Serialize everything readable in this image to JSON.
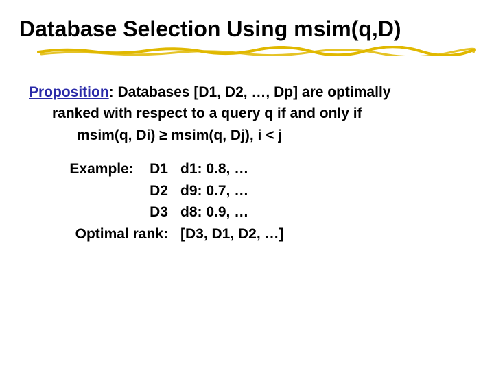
{
  "title": "Database Selection Using msim(q,D)",
  "proposition": {
    "label": "Proposition",
    "line1_rest": ": Databases [D1, D2, …, Dp] are optimally",
    "line2": "ranked with respect to a query q if and only if",
    "line3": "msim(q, Di) ≥ msim(q, Dj), i < j"
  },
  "example": {
    "label": "Example:",
    "rows": [
      {
        "db": "D1",
        "val": "d1: 0.8,  …"
      },
      {
        "db": "D2",
        "val": "d9: 0.7,  …"
      },
      {
        "db": "D3",
        "val": "d8: 0.9,  …"
      }
    ],
    "optimal_label": "Optimal rank:",
    "optimal_value": "[D3, D1, D2, …]"
  }
}
